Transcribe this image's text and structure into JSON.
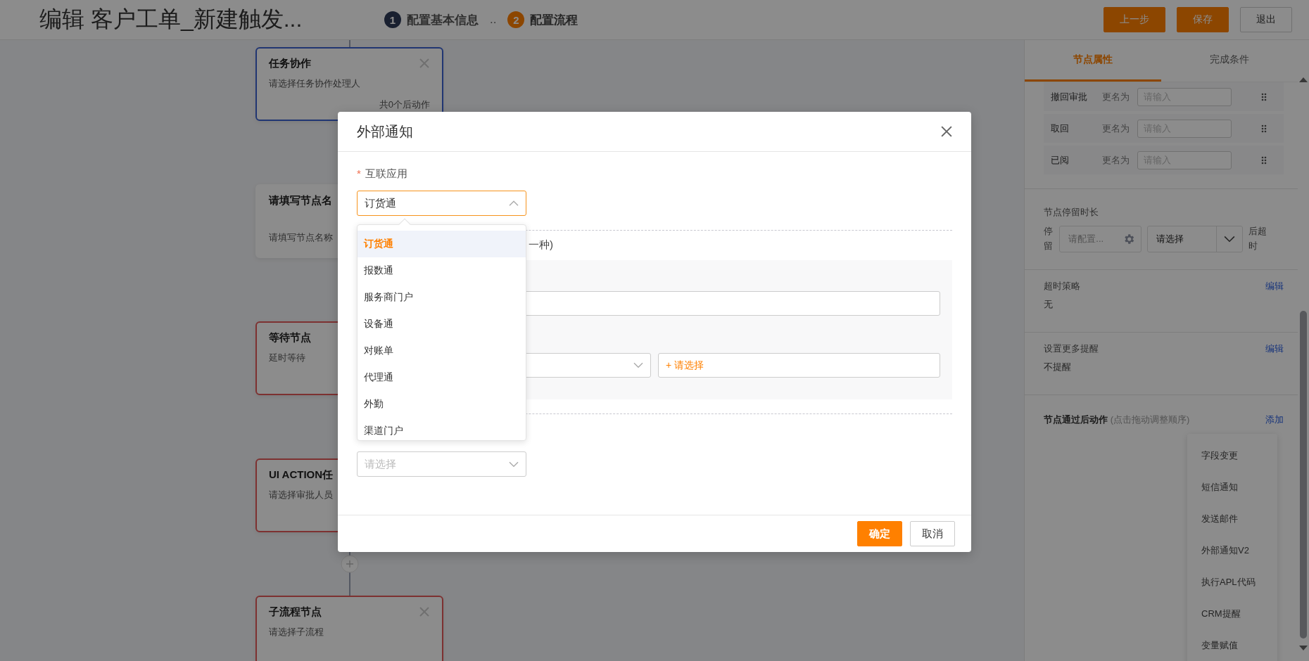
{
  "header": {
    "title": "编辑 客户工单_新建触发...",
    "steps": [
      {
        "number": "1",
        "label": "配置基本信息",
        "selected": false
      },
      {
        "number": "2",
        "label": "配置流程",
        "selected": true
      }
    ],
    "separator": "..",
    "buttons": [
      {
        "label": "上一步",
        "kind": "primary"
      },
      {
        "label": "保存",
        "kind": "primary"
      },
      {
        "label": "退出",
        "kind": "default"
      }
    ]
  },
  "canvas": {
    "nodes": [
      {
        "title": "任务协作",
        "subtitle": "请选择任务协作处理人",
        "footer": "共0个后动作",
        "selected": true,
        "error": false,
        "closable": true
      },
      {
        "title": "请填写节点名",
        "subtitle": "请填写节点名称",
        "selected": false,
        "error": false,
        "closable": false
      },
      {
        "title": "等待节点",
        "subtitle": "延时等待",
        "selected": false,
        "error": true,
        "closable": false
      },
      {
        "title": "UI ACTION任",
        "subtitle": "请选择审批人员",
        "selected": false,
        "error": true,
        "closable": false
      },
      {
        "title": "子流程节点",
        "subtitle": "请选择子流程",
        "selected": false,
        "error": true,
        "closable": true
      }
    ]
  },
  "panel": {
    "tabs": [
      {
        "label": "节点属性",
        "selected": true
      },
      {
        "label": "完成条件",
        "selected": false
      }
    ],
    "rename_rows": [
      {
        "name": "撤回审批",
        "rename_label": "更名为",
        "placeholder": "请输入"
      },
      {
        "name": "取回",
        "rename_label": "更名为",
        "placeholder": "请输入"
      },
      {
        "name": "已阅",
        "rename_label": "更名为",
        "placeholder": "请输入"
      }
    ],
    "stay_duration": {
      "title": "节点停留时长",
      "prefix": "停留",
      "field_placeholder": "请配置...",
      "select_value": "请选择",
      "suffix": "后超时"
    },
    "timeout_policy": {
      "title": "超时策略",
      "value": "无",
      "action": "编辑"
    },
    "reminders": {
      "title": "设置更多提醒",
      "value": "不提醒",
      "action": "编辑"
    },
    "post_actions": {
      "title": "节点通过后动作",
      "hint": "(点击拖动调整顺序)",
      "action": "添加",
      "menu": [
        "字段变更",
        "短信通知",
        "发送邮件",
        "外部通知V2",
        "执行APL代码",
        "CRM提醒",
        "变量赋值"
      ]
    }
  },
  "dialog": {
    "title": "外部通知",
    "field_label": "互联应用",
    "required": true,
    "required_mark": "*",
    "select_value": "订货通",
    "expanded": true,
    "options": [
      {
        "label": "订货通",
        "selected": true
      },
      {
        "label": "报数通",
        "selected": false
      },
      {
        "label": "服务商门户",
        "selected": false
      },
      {
        "label": "设备通",
        "selected": false
      },
      {
        "label": "对账单",
        "selected": false
      },
      {
        "label": "代理通",
        "selected": false
      },
      {
        "label": "外勤",
        "selected": false
      },
      {
        "label": "渠道门户",
        "selected": false
      }
    ],
    "partial_label": "一种)",
    "add_placeholder": "+ 请选择",
    "bottom_select_placeholder": "请选择",
    "buttons": [
      {
        "label": "确定",
        "kind": "primary"
      },
      {
        "label": "取消",
        "kind": "default"
      }
    ]
  }
}
